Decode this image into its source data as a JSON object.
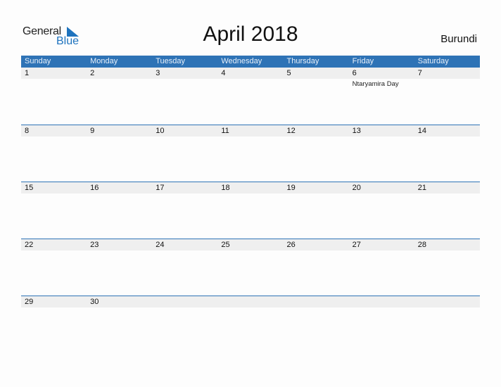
{
  "logo": {
    "word1": "General",
    "word2": "Blue"
  },
  "title": "April 2018",
  "country": "Burundi",
  "colors": {
    "header": "#2e73b6",
    "band": "#efefef",
    "logo_blue": "#1e73be"
  },
  "weekdays": [
    "Sunday",
    "Monday",
    "Tuesday",
    "Wednesday",
    "Thursday",
    "Friday",
    "Saturday"
  ],
  "weeks": [
    {
      "days": [
        "1",
        "2",
        "3",
        "4",
        "5",
        "6",
        "7"
      ],
      "events": [
        "",
        "",
        "",
        "",
        "",
        "Ntaryamira Day",
        ""
      ]
    },
    {
      "days": [
        "8",
        "9",
        "10",
        "11",
        "12",
        "13",
        "14"
      ],
      "events": [
        "",
        "",
        "",
        "",
        "",
        "",
        ""
      ]
    },
    {
      "days": [
        "15",
        "16",
        "17",
        "18",
        "19",
        "20",
        "21"
      ],
      "events": [
        "",
        "",
        "",
        "",
        "",
        "",
        ""
      ]
    },
    {
      "days": [
        "22",
        "23",
        "24",
        "25",
        "26",
        "27",
        "28"
      ],
      "events": [
        "",
        "",
        "",
        "",
        "",
        "",
        ""
      ]
    },
    {
      "days": [
        "29",
        "30",
        "",
        "",
        "",
        "",
        ""
      ],
      "events": [
        "",
        "",
        "",
        "",
        "",
        "",
        ""
      ]
    }
  ]
}
